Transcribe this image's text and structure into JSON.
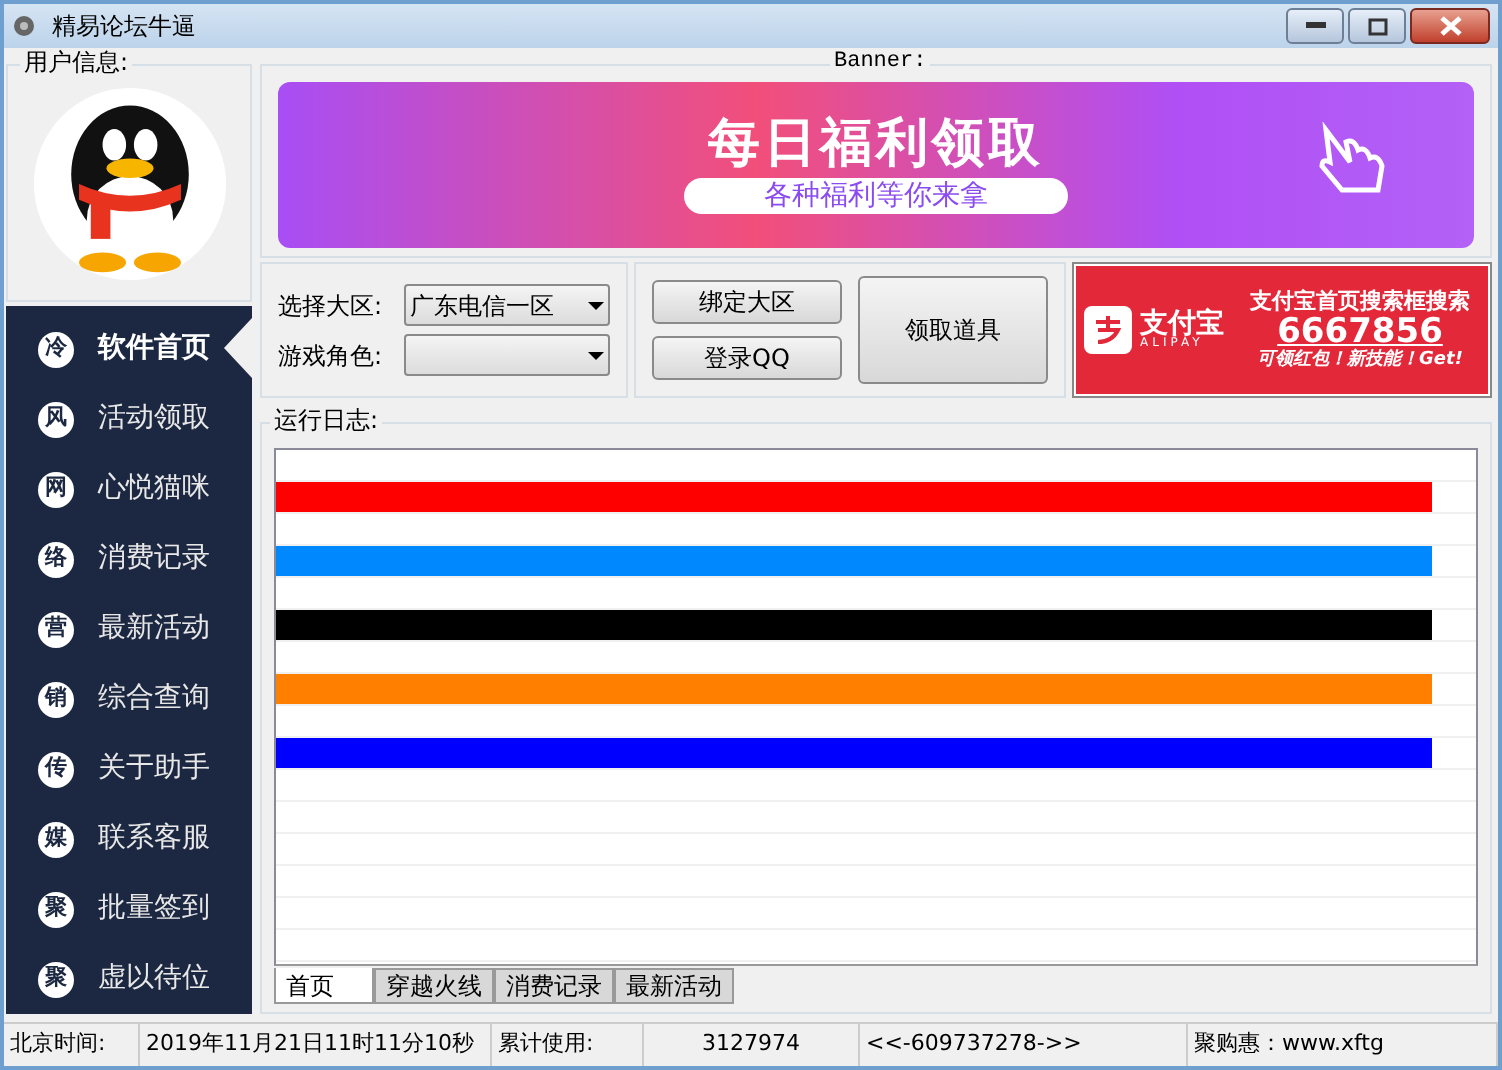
{
  "window": {
    "title": "精易论坛牛逼"
  },
  "user_info": {
    "label": "用户信息:"
  },
  "nav": [
    {
      "icon_char": "冷",
      "label": "软件首页",
      "selected": true
    },
    {
      "icon_char": "风",
      "label": "活动领取",
      "selected": false
    },
    {
      "icon_char": "网",
      "label": "心悦猫咪",
      "selected": false
    },
    {
      "icon_char": "络",
      "label": "消费记录",
      "selected": false
    },
    {
      "icon_char": "营",
      "label": "最新活动",
      "selected": false
    },
    {
      "icon_char": "销",
      "label": "综合查询",
      "selected": false
    },
    {
      "icon_char": "传",
      "label": "关于助手",
      "selected": false
    },
    {
      "icon_char": "媒",
      "label": "联系客服",
      "selected": false
    },
    {
      "icon_char": "聚",
      "label": "批量签到",
      "selected": false
    },
    {
      "icon_char": "聚",
      "label": "虚以待位",
      "selected": false
    }
  ],
  "banner": {
    "label": "Banner:",
    "headline": "每日福利领取",
    "subline": "各种福利等你来拿"
  },
  "form": {
    "fields": [
      {
        "label": "选择大区:",
        "value": "广东电信一区"
      },
      {
        "label": "游戏角色:"
      }
    ],
    "buttons": [
      "绑定大区",
      "登录QQ"
    ],
    "big_button": "领取道具"
  },
  "ad": {
    "brand": "支付宝",
    "brand_sub": "ALIPAY",
    "line1": "支付宝首页搜索框搜索",
    "code": "6667856",
    "line3": "可领红包！新技能！Get!"
  },
  "log": {
    "label": "运行日志:",
    "rows": [
      {
        "kind": "blank"
      },
      {
        "kind": "bar",
        "color": "#ff0000"
      },
      {
        "kind": "blank"
      },
      {
        "kind": "bar",
        "color": "#0088ff"
      },
      {
        "kind": "blank"
      },
      {
        "kind": "bar",
        "color": "#000000"
      },
      {
        "kind": "blank"
      },
      {
        "kind": "bar",
        "color": "#ff8000"
      },
      {
        "kind": "blank"
      },
      {
        "kind": "bar",
        "color": "#0000ff"
      },
      {
        "kind": "blank"
      },
      {
        "kind": "blank"
      },
      {
        "kind": "blank"
      },
      {
        "kind": "blank"
      },
      {
        "kind": "blank"
      },
      {
        "kind": "blank"
      }
    ],
    "tabs": [
      {
        "label": "首页",
        "selected": true
      },
      {
        "label": "穿越火线",
        "selected": false
      },
      {
        "label": "消费记录",
        "selected": false
      },
      {
        "label": "最新活动",
        "selected": false
      }
    ]
  },
  "status_bar": [
    "北京时间:",
    "2019年11月21日11时11分10秒",
    "累计使用:",
    "3127974",
    "<<-609737278->>",
    "聚购惠：www.xftg"
  ]
}
